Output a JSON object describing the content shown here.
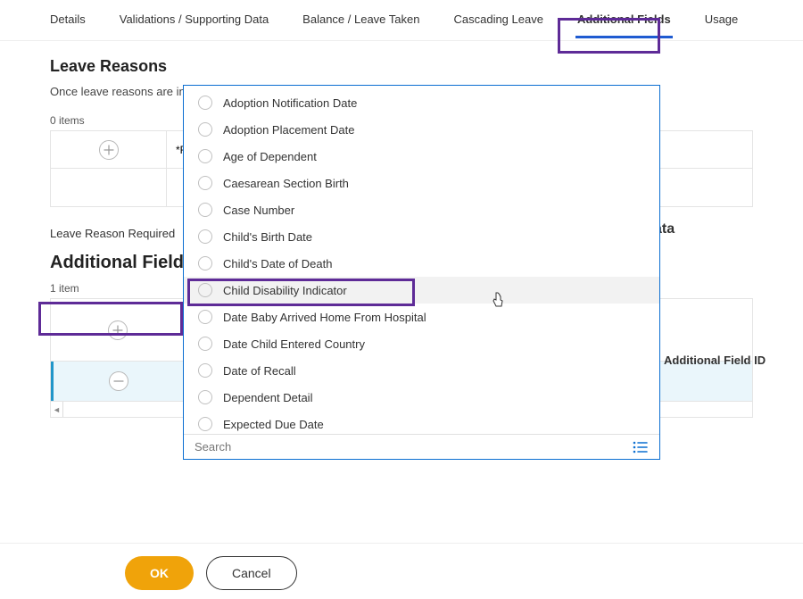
{
  "tabs": {
    "details": "Details",
    "validations": "Validations / Supporting Data",
    "balance": "Balance / Leave Taken",
    "cascading": "Cascading Leave",
    "additional": "Additional Fields",
    "usage": "Usage"
  },
  "section1": {
    "title": "Leave Reasons",
    "subtext": "Once leave reasons are in us",
    "count": "0 items",
    "required_prefix": "*R"
  },
  "label_required": "Leave Reason Required",
  "section2": {
    "title": "Additional Fields",
    "count": "1 item",
    "col_end": "Additional Field ID"
  },
  "float_label": "ata",
  "dropdown": {
    "options": [
      "Adoption Notification Date",
      "Adoption Placement Date",
      "Age of Dependent",
      "Caesarean Section Birth",
      "Case Number",
      "Child's Birth Date",
      "Child's Date of Death",
      "Child Disability Indicator",
      "Date Baby Arrived Home From Hospital",
      "Date Child Entered Country",
      "Date of Recall",
      "Dependent Detail",
      "Expected Due Date"
    ],
    "hovered_index": 7,
    "search_placeholder": "Search"
  },
  "footer": {
    "ok": "OK",
    "cancel": "Cancel"
  }
}
